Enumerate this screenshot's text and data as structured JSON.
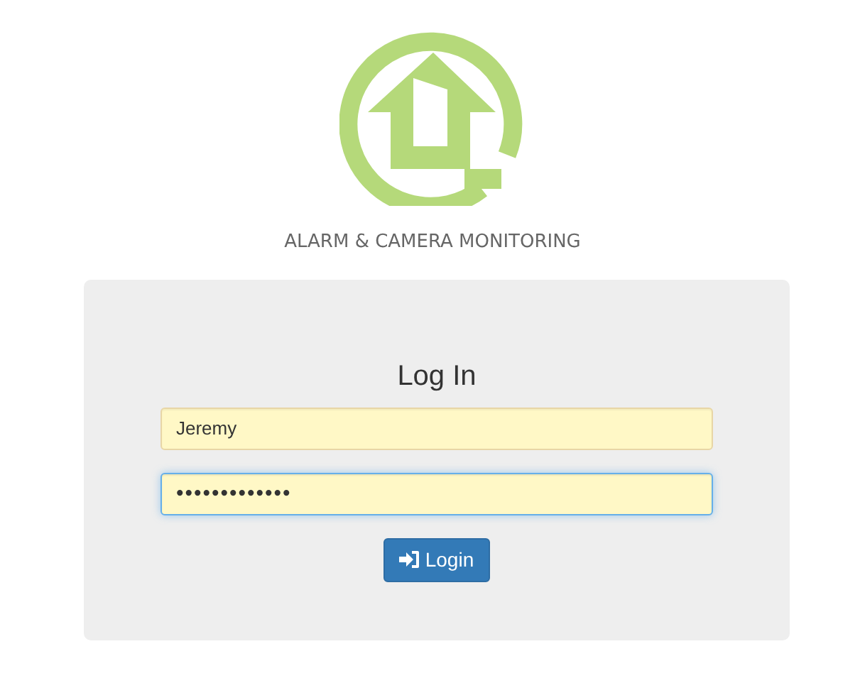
{
  "brand": {
    "tagline": "ALARM & CAMERA MONITORING"
  },
  "login": {
    "title": "Log In",
    "fields": [
      {
        "kind": "text",
        "value": "Jeremy",
        "focused": false
      },
      {
        "kind": "password",
        "value": "•••••••••••••",
        "focused": true
      }
    ],
    "button": {
      "label": "Login"
    }
  }
}
